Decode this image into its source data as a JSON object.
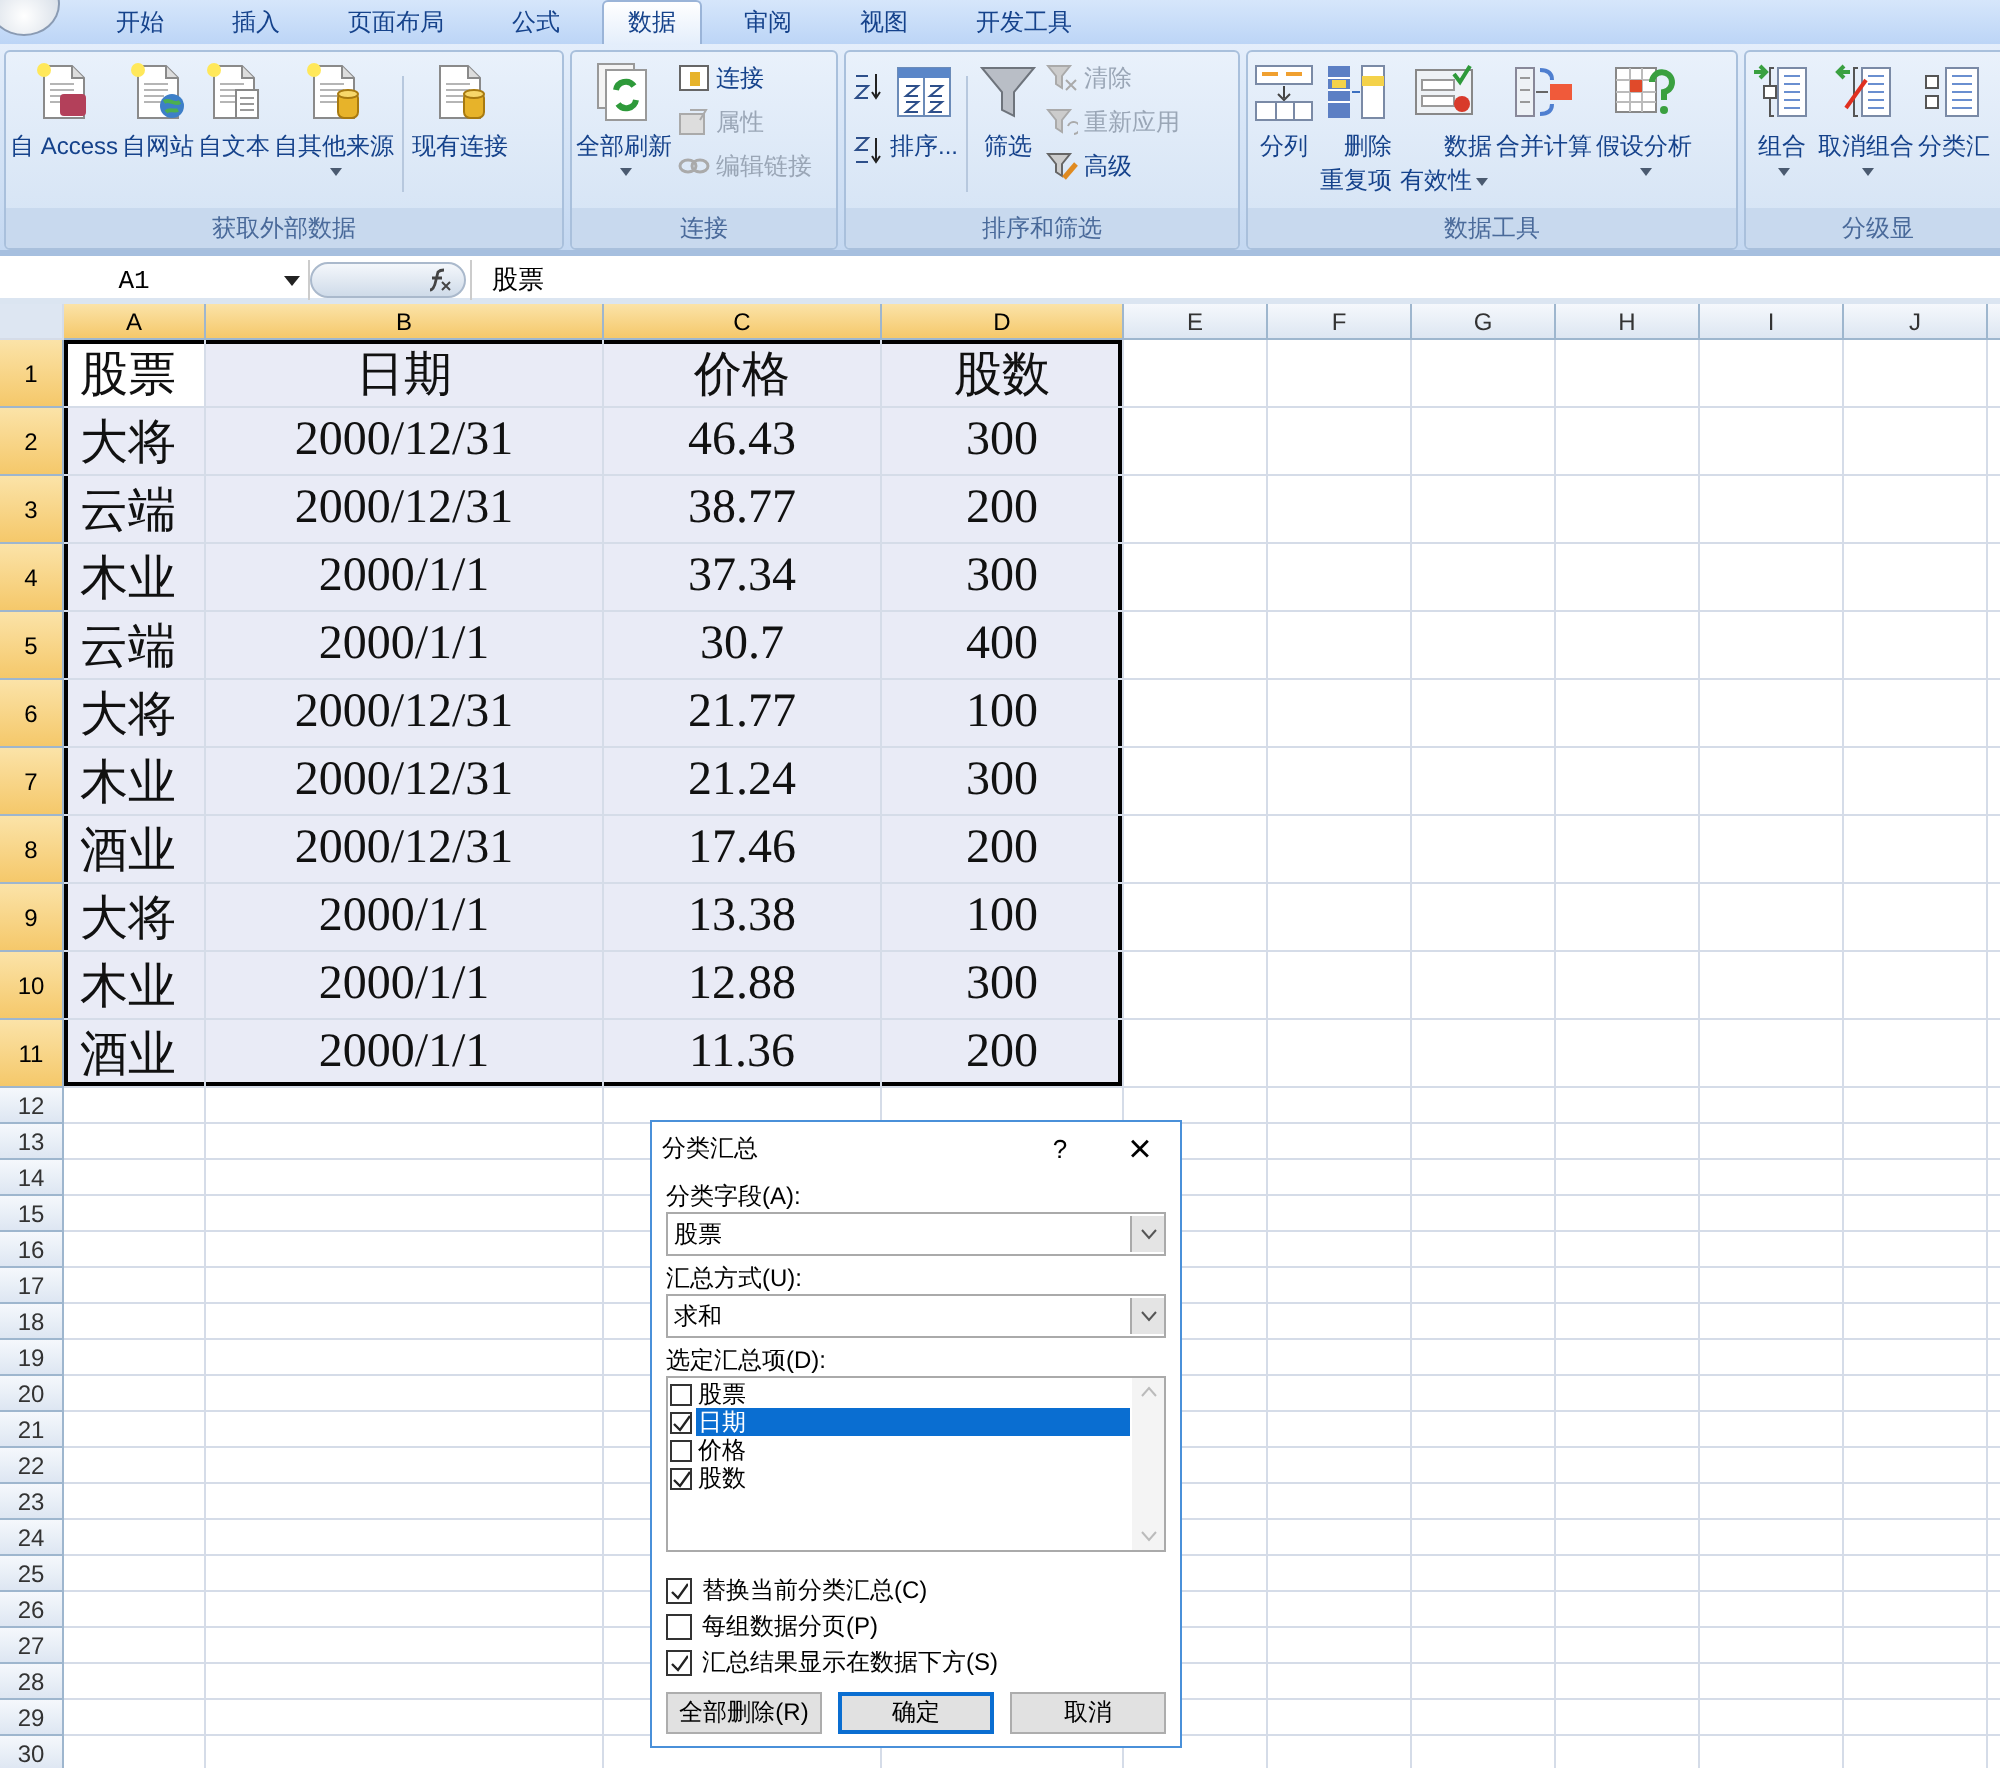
{
  "tabs": [
    {
      "label": "开始",
      "selected": false
    },
    {
      "label": "插入",
      "selected": false
    },
    {
      "label": "页面布局",
      "selected": false
    },
    {
      "label": "公式",
      "selected": false
    },
    {
      "label": "数据",
      "selected": true
    },
    {
      "label": "审阅",
      "selected": false
    },
    {
      "label": "视图",
      "selected": false
    },
    {
      "label": "开发工具",
      "selected": false
    }
  ],
  "ribbon_groups": [
    {
      "label": "获取外部数据",
      "items": [
        {
          "kind": "large",
          "label": "自 Access",
          "disabled": false,
          "dropdown": false
        },
        {
          "kind": "large",
          "label": "自网站",
          "disabled": false,
          "dropdown": false
        },
        {
          "kind": "large",
          "label": "自文本",
          "disabled": false,
          "dropdown": false
        },
        {
          "kind": "large",
          "label": "自其他来源",
          "disabled": false,
          "dropdown": true
        },
        {
          "kind": "separator"
        },
        {
          "kind": "large",
          "label": "现有连接",
          "disabled": false,
          "dropdown": false
        }
      ]
    },
    {
      "label": "连接",
      "items": [
        {
          "kind": "large",
          "label": "全部刷新",
          "disabled": false,
          "dropdown": true
        },
        {
          "kind": "stack",
          "items": [
            {
              "label": "连接",
              "disabled": false
            },
            {
              "label": "属性",
              "disabled": true
            },
            {
              "label": "编辑链接",
              "disabled": true
            }
          ]
        }
      ]
    },
    {
      "label": "排序和筛选",
      "items": [
        {
          "kind": "sort-stack"
        },
        {
          "kind": "large",
          "label": "排序...",
          "disabled": false,
          "dropdown": false
        },
        {
          "kind": "separator"
        },
        {
          "kind": "large",
          "label": "筛选",
          "disabled": false,
          "dropdown": false
        },
        {
          "kind": "stack",
          "items": [
            {
              "label": "清除",
              "disabled": true
            },
            {
              "label": "重新应用",
              "disabled": true
            },
            {
              "label": "高级",
              "disabled": false
            }
          ]
        }
      ]
    },
    {
      "label": "数据工具",
      "items": [
        {
          "kind": "large",
          "label": "分列",
          "disabled": false,
          "dropdown": false
        },
        {
          "kind": "large-two-line",
          "label": "删除重复项",
          "disabled": false,
          "dropdown": false
        },
        {
          "kind": "large-two-line",
          "label": "数据有效性",
          "disabled": false,
          "dropdown": true
        },
        {
          "kind": "large",
          "label": "合并计算",
          "disabled": false,
          "dropdown": false
        },
        {
          "kind": "large",
          "label": "假设分析",
          "disabled": false,
          "dropdown": true
        }
      ]
    },
    {
      "label": "分级显",
      "items": [
        {
          "kind": "large",
          "label": "组合",
          "disabled": false,
          "dropdown": true
        },
        {
          "kind": "large",
          "label": "取消组合",
          "disabled": false,
          "dropdown": true
        },
        {
          "kind": "large",
          "label": "分类汇",
          "disabled": false,
          "dropdown": false
        }
      ]
    }
  ],
  "formula_bar": {
    "name_box": "A1",
    "formula": "股票"
  },
  "sheet": {
    "columns": [
      {
        "label": "A",
        "selected": true
      },
      {
        "label": "B",
        "selected": true
      },
      {
        "label": "C",
        "selected": true
      },
      {
        "label": "D",
        "selected": true
      },
      {
        "label": "E",
        "selected": false
      },
      {
        "label": "F",
        "selected": false
      },
      {
        "label": "G",
        "selected": false
      },
      {
        "label": "H",
        "selected": false
      },
      {
        "label": "I",
        "selected": false
      },
      {
        "label": "J",
        "selected": false
      }
    ],
    "rows": [
      {
        "number": "1",
        "selected": true,
        "cells": [
          "股票",
          "日期",
          "价格",
          "股数"
        ]
      },
      {
        "number": "2",
        "selected": true,
        "cells": [
          "大将",
          "2000/12/31",
          "46.43",
          "300"
        ]
      },
      {
        "number": "3",
        "selected": true,
        "cells": [
          "云端",
          "2000/12/31",
          "38.77",
          "200"
        ]
      },
      {
        "number": "4",
        "selected": true,
        "cells": [
          "木业",
          "2000/1/1",
          "37.34",
          "300"
        ]
      },
      {
        "number": "5",
        "selected": true,
        "cells": [
          "云端",
          "2000/1/1",
          "30.7",
          "400"
        ]
      },
      {
        "number": "6",
        "selected": true,
        "cells": [
          "大将",
          "2000/12/31",
          "21.77",
          "100"
        ]
      },
      {
        "number": "7",
        "selected": true,
        "cells": [
          "木业",
          "2000/12/31",
          "21.24",
          "300"
        ]
      },
      {
        "number": "8",
        "selected": true,
        "cells": [
          "酒业",
          "2000/12/31",
          "17.46",
          "200"
        ]
      },
      {
        "number": "9",
        "selected": true,
        "cells": [
          "大将",
          "2000/1/1",
          "13.38",
          "100"
        ]
      },
      {
        "number": "10",
        "selected": true,
        "cells": [
          "木业",
          "2000/1/1",
          "12.88",
          "300"
        ]
      },
      {
        "number": "11",
        "selected": true,
        "cells": [
          "酒业",
          "2000/1/1",
          "11.36",
          "200"
        ]
      },
      {
        "number": "12",
        "selected": false,
        "cells": []
      },
      {
        "number": "13",
        "selected": false,
        "cells": []
      },
      {
        "number": "14",
        "selected": false,
        "cells": []
      },
      {
        "number": "15",
        "selected": false,
        "cells": []
      },
      {
        "number": "16",
        "selected": false,
        "cells": []
      },
      {
        "number": "17",
        "selected": false,
        "cells": []
      },
      {
        "number": "18",
        "selected": false,
        "cells": []
      },
      {
        "number": "19",
        "selected": false,
        "cells": []
      },
      {
        "number": "20",
        "selected": false,
        "cells": []
      },
      {
        "number": "21",
        "selected": false,
        "cells": []
      },
      {
        "number": "22",
        "selected": false,
        "cells": []
      },
      {
        "number": "23",
        "selected": false,
        "cells": []
      },
      {
        "number": "24",
        "selected": false,
        "cells": []
      },
      {
        "number": "25",
        "selected": false,
        "cells": []
      },
      {
        "number": "26",
        "selected": false,
        "cells": []
      },
      {
        "number": "27",
        "selected": false,
        "cells": []
      },
      {
        "number": "28",
        "selected": false,
        "cells": []
      },
      {
        "number": "29",
        "selected": false,
        "cells": []
      },
      {
        "number": "30",
        "selected": false,
        "cells": []
      }
    ]
  },
  "dialog": {
    "title": "分类汇总",
    "help": "?",
    "close": "×",
    "selects": [
      {
        "label": "分类字段(A):",
        "value": "股票"
      },
      {
        "label": "汇总方式(U):",
        "value": "求和"
      }
    ],
    "list_label": "选定汇总项(D):",
    "list_items": [
      {
        "label": "股票",
        "checked": false,
        "selected": false
      },
      {
        "label": "日期",
        "checked": true,
        "selected": true
      },
      {
        "label": "价格",
        "checked": false,
        "selected": false
      },
      {
        "label": "股数",
        "checked": true,
        "selected": false
      }
    ],
    "options": [
      {
        "label": "替换当前分类汇总(C)",
        "checked": true
      },
      {
        "label": "每组数据分页(P)",
        "checked": false
      },
      {
        "label": "汇总结果显示在数据下方(S)",
        "checked": true
      }
    ],
    "buttons": [
      {
        "label": "全部删除(R)",
        "default": false
      },
      {
        "label": "确定",
        "default": true
      },
      {
        "label": "取消",
        "default": false
      }
    ]
  }
}
